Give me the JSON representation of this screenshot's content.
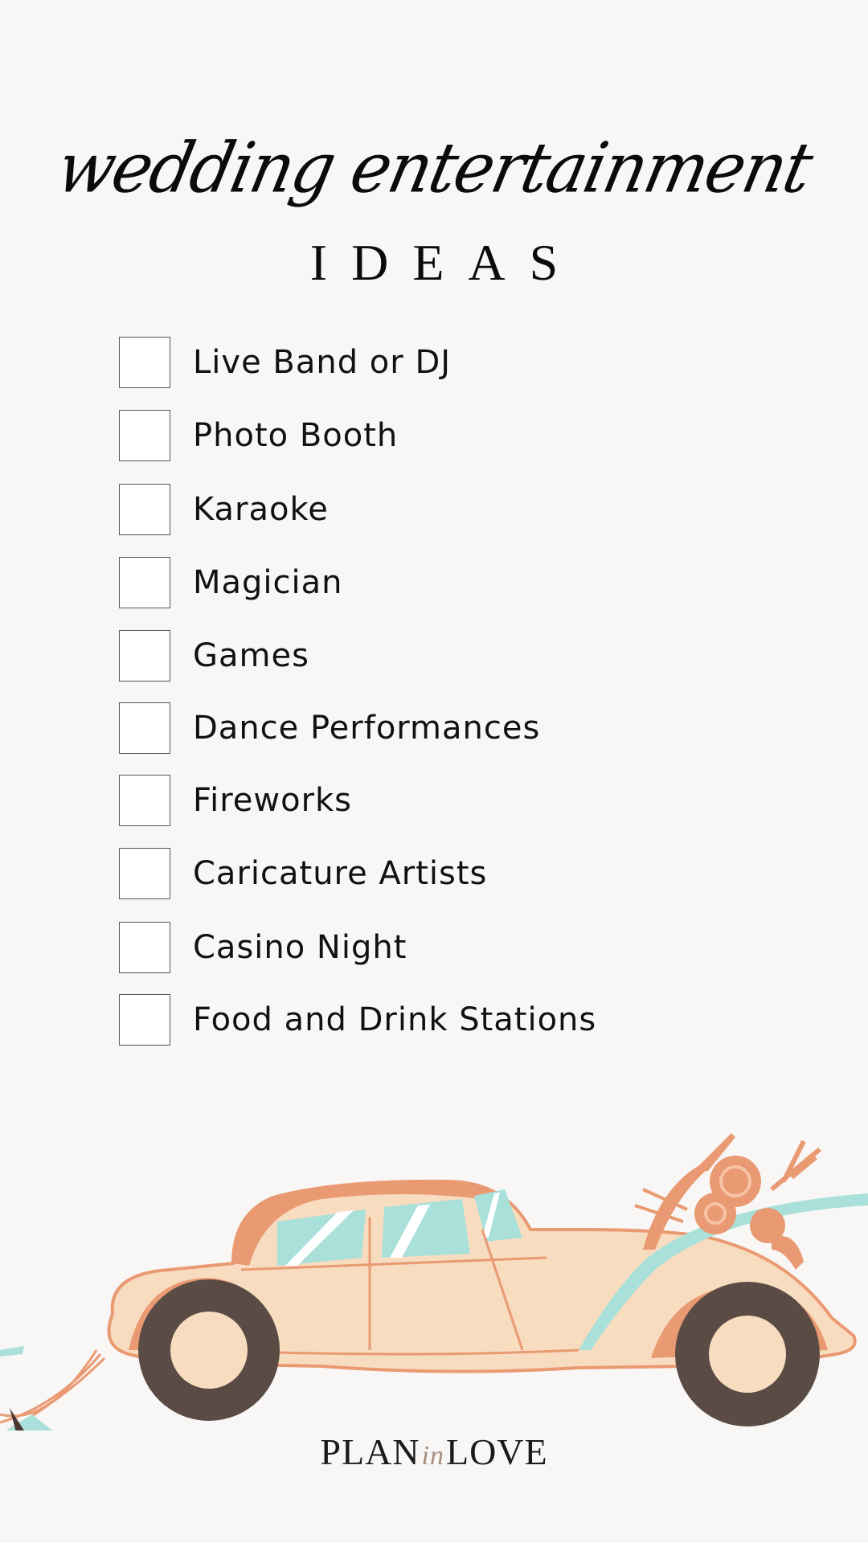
{
  "title": {
    "script": "wedding entertainment",
    "caps": "IDEAS"
  },
  "checklist": [
    {
      "label": "Live Band or DJ",
      "checked": false
    },
    {
      "label": "Photo Booth",
      "checked": false
    },
    {
      "label": "Karaoke",
      "checked": false
    },
    {
      "label": "Magician",
      "checked": false
    },
    {
      "label": "Games",
      "checked": false
    },
    {
      "label": "Dance Performances",
      "checked": false
    },
    {
      "label": "Fireworks",
      "checked": false
    },
    {
      "label": "Caricature Artists",
      "checked": false
    },
    {
      "label": "Casino Night",
      "checked": false
    },
    {
      "label": "Food and Drink Stations",
      "checked": false
    }
  ],
  "brand": {
    "left": "PLAN",
    "middle": "in",
    "right": "LOVE"
  },
  "colors": {
    "background": "#f8f7f6",
    "car_body": "#f7dcbf",
    "car_trim": "#ea9a72",
    "glass": "#a9e0da",
    "tire": "#5a4b45",
    "brand_accent": "#a58f80"
  }
}
